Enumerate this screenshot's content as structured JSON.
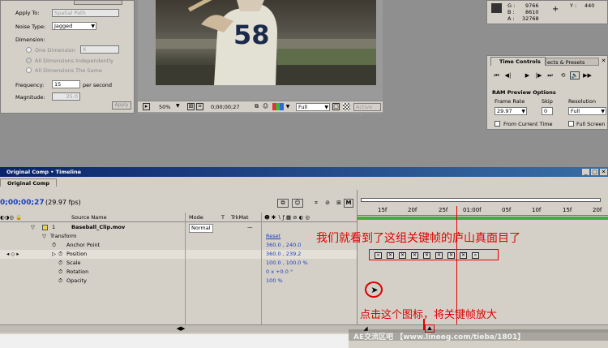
{
  "wiggler": {
    "apply_to_label": "Apply To:",
    "apply_to_value": "Spatial Path",
    "noise_type_label": "Noise Type:",
    "noise_type_value": "Jagged",
    "dimension_label": "Dimension:",
    "one_dimension": "One Dimension",
    "one_dimension_axis": "X",
    "all_independently": "All Dimensions Independently",
    "all_same": "All Dimensions The Same",
    "frequency_label": "Frequency:",
    "frequency_value": "15",
    "frequency_unit": "per second",
    "magnitude_label": "Magnitude:",
    "magnitude_value": "25.0",
    "apply_button": "Apply",
    "tab_title": "...gler"
  },
  "comp_viewer": {
    "zoom": "50%",
    "timecode": "0;00;00;27",
    "resolution": "Full",
    "active_camera": "Active Ca"
  },
  "info": {
    "g_label": "G :",
    "g_value": "9766",
    "b_label": "B :",
    "b_value": "8610",
    "a_label": "A :",
    "a_value": "32768",
    "y_label": "Y :",
    "y_value": "440"
  },
  "time_controls": {
    "tab_title": "Time Controls",
    "tab2": "ects & Presets",
    "ram_title": "RAM Preview Options",
    "frame_rate_label": "Frame Rate",
    "frame_rate_value": "29.97",
    "skip_label": "Skip",
    "skip_value": "0",
    "resolution_label": "Resolution",
    "resolution_value": "Full",
    "from_current": "From Current Time",
    "full_screen": "Full Screen"
  },
  "timeline": {
    "window_title": "Original Comp • Timeline",
    "tab_label": "Original Comp",
    "current_time": "0;00;00;27",
    "fps": "(29.97 fps)",
    "col_source_name": "Source Name",
    "col_mode": "Mode",
    "col_t": "T",
    "col_trkmat": "TrkMat",
    "ruler": [
      "15f",
      "20f",
      "25f",
      "01:00f",
      "05f",
      "10f",
      "15f",
      "20f"
    ],
    "layer": {
      "number": "1",
      "name": "Baseball_Clip.mov",
      "mode": "Normal"
    },
    "rows": [
      {
        "name": "Transform",
        "value": "Reset"
      },
      {
        "name": "Anchor Point",
        "value": "360.0 , 240.0"
      },
      {
        "name": "Position",
        "value": "360.0 , 239.2"
      },
      {
        "name": "Scale",
        "value": "100.0 , 100.0 %"
      },
      {
        "name": "Rotation",
        "value": "0 x +0.0 °"
      },
      {
        "name": "Opacity",
        "value": "100 %"
      }
    ]
  },
  "annotations": {
    "top": "我们就看到了这组关键帧的庐山真面目了",
    "bottom": "点击这个图标，将关键帧放大"
  },
  "watermark": "AE交流区吧 【www.lineeg.com/tieba/1801】",
  "colors": {
    "annotation": "#e00000",
    "link_blue": "#1a3fbf",
    "work_area": "#3fae3f",
    "panel": "#d4d0c8",
    "title_bar": "#0a246a"
  }
}
